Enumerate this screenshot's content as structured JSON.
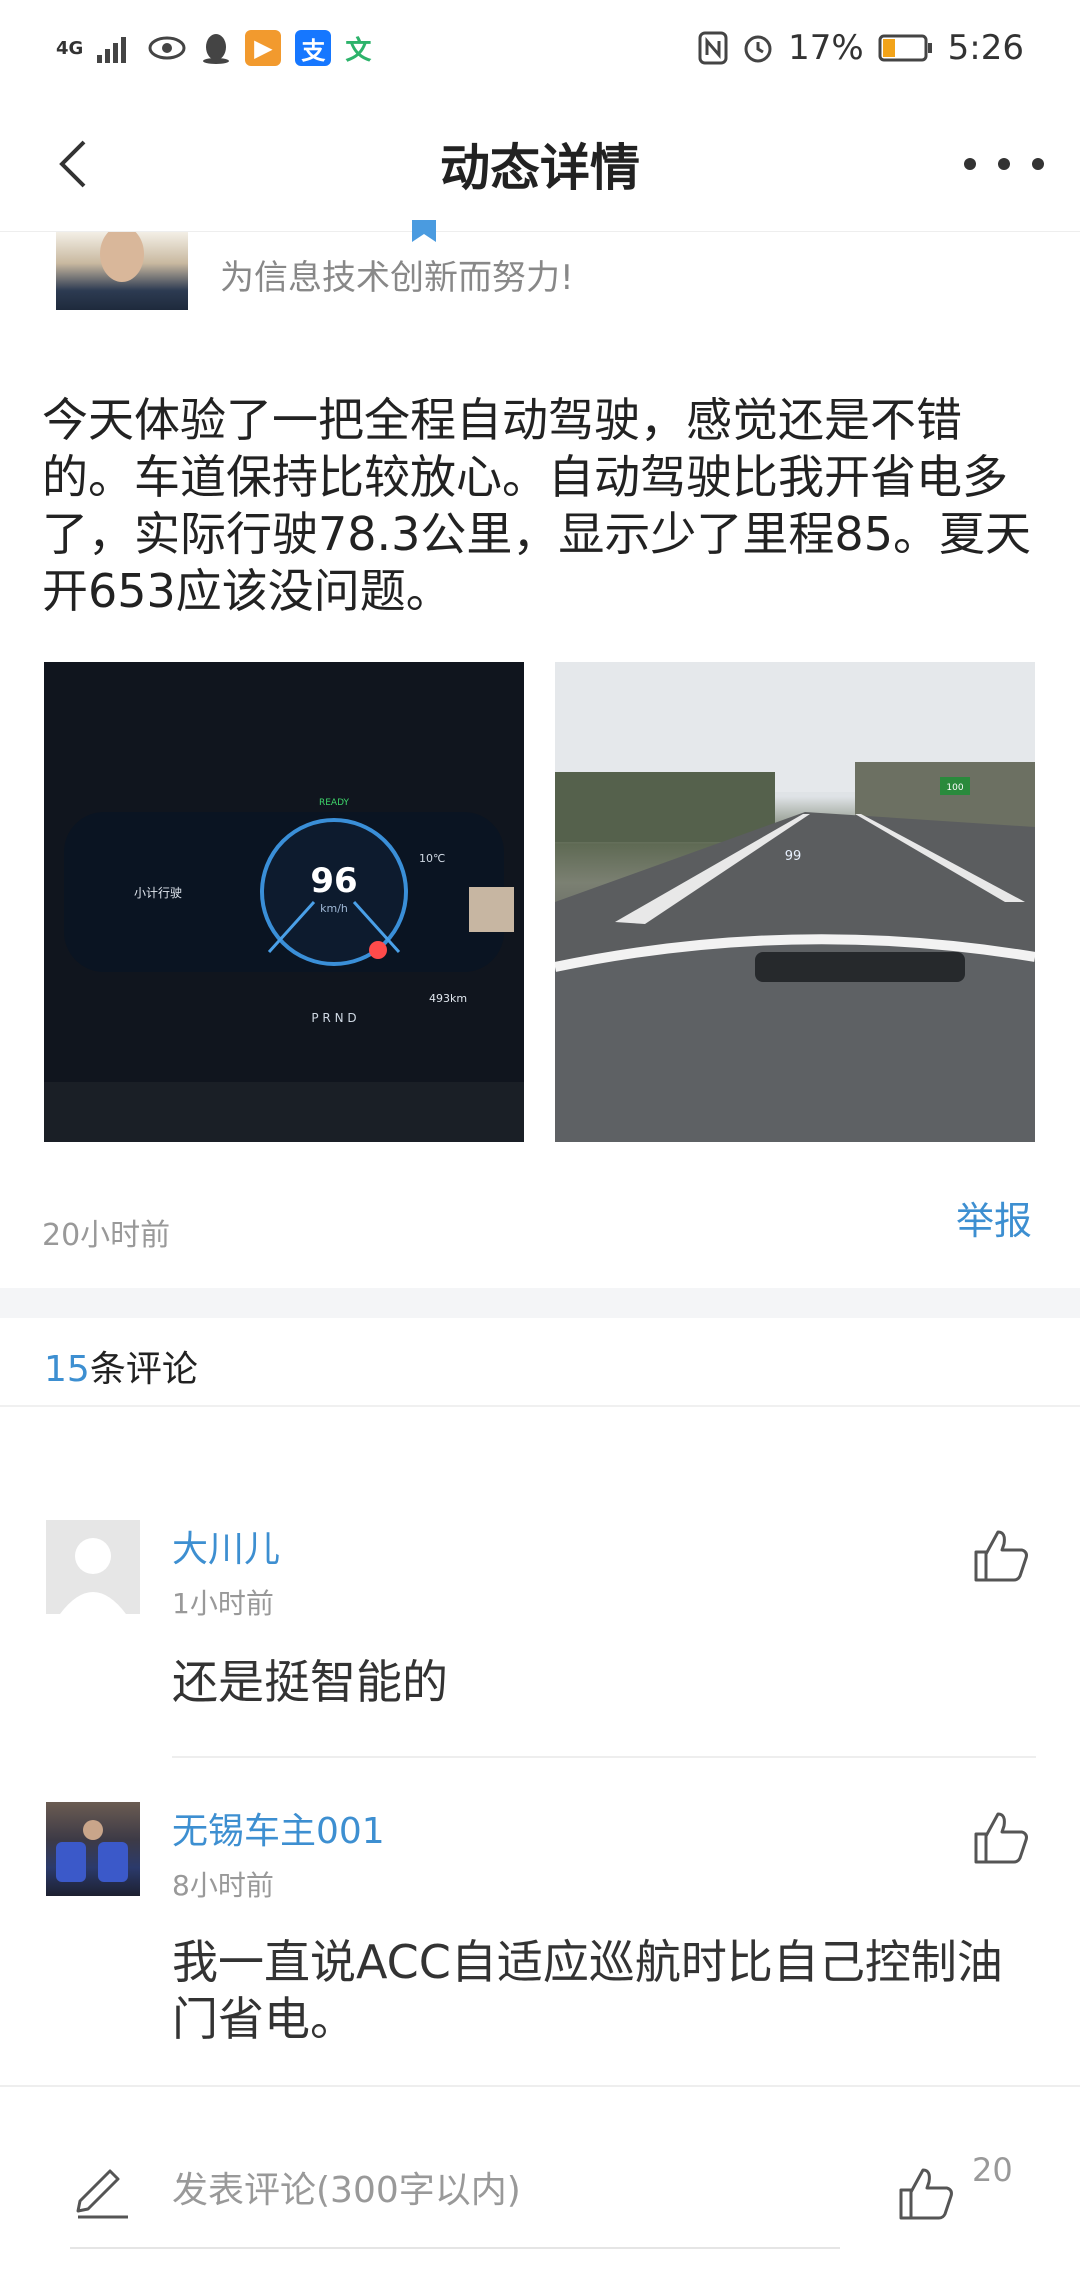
{
  "status_bar": {
    "network": "4G",
    "battery": "17%",
    "time": "5:26"
  },
  "nav": {
    "title": "动态详情"
  },
  "author": {
    "bio": "为信息技术创新而努力!"
  },
  "post": {
    "text": "今天体验了一把全程自动驾驶，感觉还是不错的。车道保持比较放心。自动驾驶比我开省电多了，实际行驶78.3公里，显示少了里程85。夏天开653应该没问题。",
    "time": "20小时前",
    "report_label": "举报",
    "photo1": {
      "ready": "READY",
      "speed": "96",
      "speed_unit": "km/h",
      "gears": "P R N D",
      "temp": "10℃",
      "trip_label": "小计行驶",
      "range": "493km"
    },
    "photo2": {
      "sign": "100",
      "hud_speed": "99"
    }
  },
  "comments_section": {
    "count": "15",
    "count_suffix": "条评论"
  },
  "comments": [
    {
      "user": "大川儿",
      "time": "1小时前",
      "text": "还是挺智能的"
    },
    {
      "user": "无锡车主001",
      "time": "8小时前",
      "text": "我一直说ACC自适应巡航时比自己控制油门省电。"
    }
  ],
  "bottom": {
    "input_placeholder": "发表评论(300字以内)",
    "like_count": "20"
  },
  "colors": {
    "accent": "#3d8fd1",
    "muted": "#999999",
    "text": "#222222"
  }
}
